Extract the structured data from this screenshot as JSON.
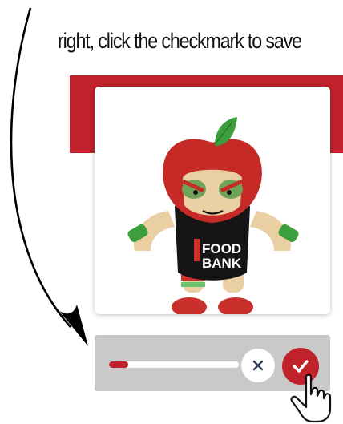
{
  "instruction": {
    "text": "right, click the checkmark to save"
  },
  "card": {
    "mascot": {
      "icon": "food-bank-apple-wrestler-mascot",
      "shirt_text_top": "FOOD",
      "shirt_text_bottom": "BANK"
    }
  },
  "toolbar": {
    "progress": 0.15,
    "cancel_icon": "close-icon",
    "confirm_icon": "checkmark-icon"
  },
  "colors": {
    "accent": "#bf222b",
    "toolbar_bg": "#c9c9c9"
  }
}
